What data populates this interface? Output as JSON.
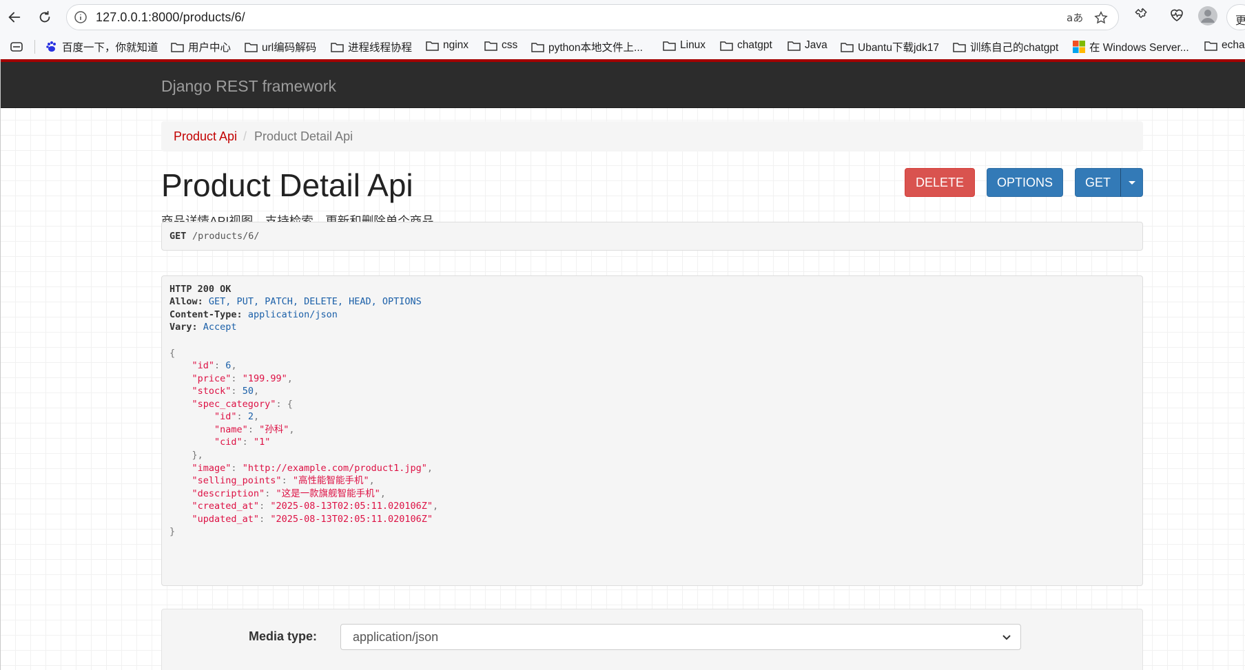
{
  "browser": {
    "url": "127.0.0.1:8000/products/6/",
    "bookmarks": [
      {
        "label": "百度一下，你就知道",
        "icon": "baidu-paw-icon"
      },
      {
        "label": "用户中心",
        "icon": "folder-icon"
      },
      {
        "label": "url编码解码",
        "icon": "folder-icon"
      },
      {
        "label": "进程线程协程",
        "icon": "folder-icon"
      },
      {
        "label": "nginx",
        "icon": "folder-icon"
      },
      {
        "label": "css",
        "icon": "folder-icon"
      },
      {
        "label": "python本地文件上...",
        "icon": "folder-icon"
      },
      {
        "label": "Linux",
        "icon": "folder-icon"
      },
      {
        "label": "chatgpt",
        "icon": "folder-icon"
      },
      {
        "label": "Java",
        "icon": "folder-icon"
      },
      {
        "label": "Ubantu下载jdk17",
        "icon": "folder-icon"
      },
      {
        "label": "训练自己的chatgpt",
        "icon": "folder-icon"
      },
      {
        "label": "在 Windows Server...",
        "icon": "windows-logo-icon"
      },
      {
        "label": "echa",
        "icon": "folder-icon"
      }
    ],
    "more_label": "更"
  },
  "navbar": {
    "brand": "Django REST framework"
  },
  "breadcrumb": {
    "parent": "Product Api",
    "current": "Product Detail Api",
    "separator": "/"
  },
  "page": {
    "title": "Product Detail Api",
    "description": "商品详情API视图，支持检索、更新和删除单个商品"
  },
  "buttons": {
    "delete": "DELETE",
    "options": "OPTIONS",
    "get": "GET"
  },
  "request": {
    "method": "GET",
    "path": "/products/6/"
  },
  "response": {
    "status": "HTTP 200 OK",
    "allow_key": "Allow:",
    "allow_value": "GET, PUT, PATCH, DELETE, HEAD, OPTIONS",
    "content_type_key": "Content-Type:",
    "content_type_value": "application/json",
    "vary_key": "Vary:",
    "vary_value": "Accept",
    "body": {
      "id": "6",
      "price": "\"199.99\"",
      "stock": "50",
      "spec_category_id": "2",
      "spec_category_name": "\"孙科\"",
      "spec_category_cid": "\"1\"",
      "image": "\"http://example.com/product1.jpg\"",
      "selling_points": "\"高性能智能手机\"",
      "description": "\"这是一款旗舰智能手机\"",
      "created_at": "\"2025-08-13T02:05:11.020106Z\"",
      "updated_at": "\"2025-08-13T02:05:11.020106Z\""
    }
  },
  "form": {
    "media_type_label": "Media type:",
    "media_type_value": "application/json"
  },
  "colors": {
    "accent_red": "#a30000",
    "delete_btn": "#d9534f",
    "primary_btn": "#337ab7",
    "navbar": "#2c2c2c"
  }
}
